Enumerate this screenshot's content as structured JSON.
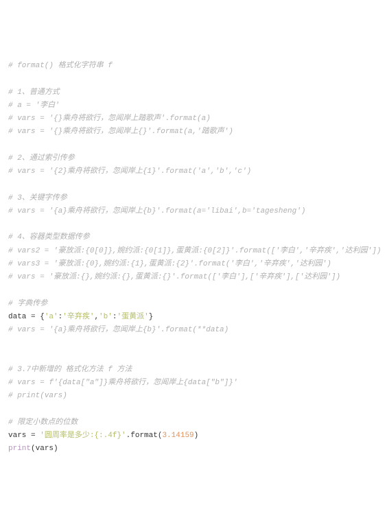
{
  "code": {
    "lines": [
      {
        "t": "c",
        "txt": "# format() 格式化字符串 f"
      },
      {
        "t": "blank"
      },
      {
        "t": "c",
        "txt": "# 1、普通方式"
      },
      {
        "t": "c",
        "txt": "# a = '李白'"
      },
      {
        "t": "c",
        "txt": "# vars = '{}乘舟将欲行，忽闻岸上踏歌声'.format(a)"
      },
      {
        "t": "c",
        "txt": "# vars = '{}乘舟将欲行，忽闻岸上{}'.format(a,'踏歌声')"
      },
      {
        "t": "blank"
      },
      {
        "t": "c",
        "txt": "# 2、通过索引传参"
      },
      {
        "t": "c",
        "txt": "# vars = '{2}乘舟将欲行，忽闻岸上{1}'.format('a','b','c')"
      },
      {
        "t": "blank"
      },
      {
        "t": "c",
        "txt": "# 3、关键字传参"
      },
      {
        "t": "c",
        "txt": "# vars = '{a}乘舟将欲行，忽闻岸上{b}'.format(a='libai',b='tagesheng')"
      },
      {
        "t": "blank"
      },
      {
        "t": "c",
        "txt": "# 4、容器类型数据传参"
      },
      {
        "t": "c",
        "txt": "# vars2 = '豪放派:{0[0]},婉约派:{0[1]},蛋黄派:{0[2]}'.format(['李白','辛弃疾','达利园'])"
      },
      {
        "t": "c",
        "txt": "# vars3 = '豪放派:{0},婉约派:{1},蛋黄派:{2}'.format('李白','辛弃疾','达利园')"
      },
      {
        "t": "c",
        "txt": "# vars = '豪放派:{},婉约派:{},蛋黄派:{}'.format(['李白'],['辛弃疾'],['达利园'])"
      },
      {
        "t": "blank"
      },
      {
        "t": "c",
        "txt": "# 字典传参"
      },
      {
        "t": "code",
        "tokens": [
          {
            "c": "id",
            "v": "data = {"
          },
          {
            "c": "str",
            "v": "'a'"
          },
          {
            "c": "id",
            "v": ":"
          },
          {
            "c": "str",
            "v": "'辛弃疾'"
          },
          {
            "c": "id",
            "v": ","
          },
          {
            "c": "str",
            "v": "'b'"
          },
          {
            "c": "id",
            "v": ":"
          },
          {
            "c": "str",
            "v": "'蛋黄派'"
          },
          {
            "c": "id",
            "v": "}"
          }
        ]
      },
      {
        "t": "c",
        "txt": "# vars = '{a}乘舟将欲行，忽闻岸上{b}'.format(**data)"
      },
      {
        "t": "blank"
      },
      {
        "t": "blank"
      },
      {
        "t": "c",
        "txt": "# 3.7中新增的 格式化方法 f 方法"
      },
      {
        "t": "c",
        "txt": "# vars = f'{data[\"a\"]}乘舟将欲行，忽闻岸上{data[\"b\"]}'"
      },
      {
        "t": "c",
        "txt": "# print(vars)"
      },
      {
        "t": "blank"
      },
      {
        "t": "c",
        "txt": "# 限定小数点的位数"
      },
      {
        "t": "code",
        "tokens": [
          {
            "c": "id",
            "v": "vars = "
          },
          {
            "c": "str",
            "v": "'圆周率是多少:{:.4f}'"
          },
          {
            "c": "id",
            "v": ".format("
          },
          {
            "c": "num",
            "v": "3.14159"
          },
          {
            "c": "id",
            "v": ")"
          }
        ]
      },
      {
        "t": "code",
        "tokens": [
          {
            "c": "kw",
            "v": "print"
          },
          {
            "c": "id",
            "v": "(vars)"
          }
        ]
      }
    ]
  }
}
